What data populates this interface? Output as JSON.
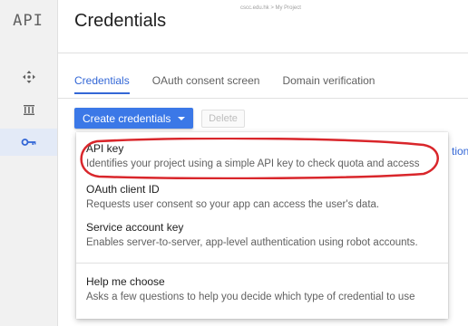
{
  "sidebar": {
    "logo": "API",
    "icons": [
      "dashboard-icon",
      "library-icon",
      "credentials-key-icon"
    ]
  },
  "header": {
    "title": "Credentials",
    "project_tag": "cscc.edu.hk > My Project"
  },
  "tabs": [
    {
      "label": "Credentials",
      "active": true
    },
    {
      "label": "OAuth consent screen",
      "active": false
    },
    {
      "label": "Domain verification",
      "active": false
    }
  ],
  "toolbar": {
    "create_label": "Create credentials",
    "delete_label": "Delete"
  },
  "stray_text": "tion",
  "menu": {
    "items": [
      {
        "title": "API key",
        "desc": "Identifies your project using a simple API key to check quota and access"
      },
      {
        "title": "OAuth client ID",
        "desc": "Requests user consent so your app can access the user's data."
      },
      {
        "title": "Service account key",
        "desc": "Enables server-to-server, app-level authentication using robot accounts."
      },
      {
        "title": "Help me choose",
        "desc": "Asks a few questions to help you decide which type of credential to use"
      }
    ]
  },
  "colors": {
    "accent": "#3b78e7",
    "annotation": "#d9262b"
  }
}
